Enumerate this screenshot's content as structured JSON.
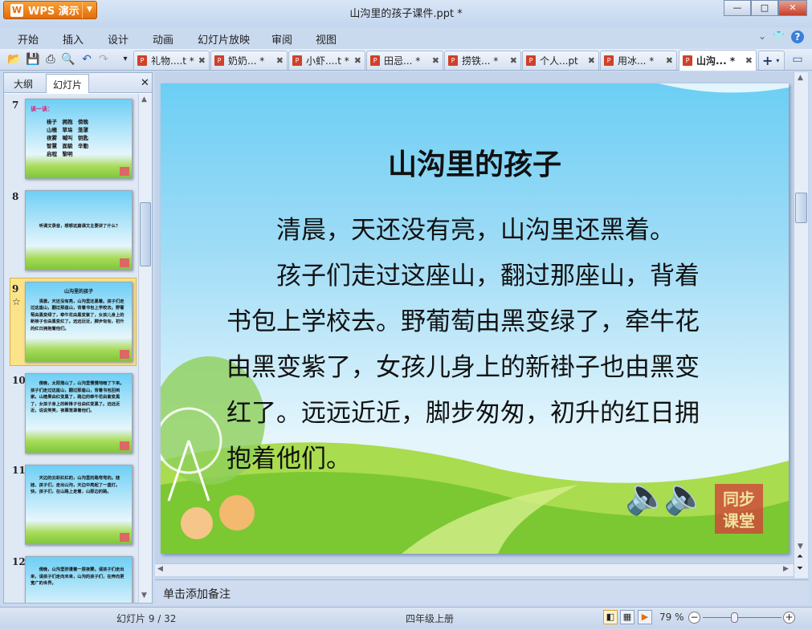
{
  "app": {
    "name": "WPS 演示",
    "title": "山沟里的孩子课件.ppt *"
  },
  "window": {
    "minimize": "—",
    "maximize": "□",
    "close": "✕"
  },
  "menu": [
    "开始",
    "插入",
    "设计",
    "动画",
    "幻灯片放映",
    "审阅",
    "视图"
  ],
  "doc_tabs": [
    {
      "label": "礼物....t *"
    },
    {
      "label": "奶奶... *"
    },
    {
      "label": "小虾....t *"
    },
    {
      "label": "田忌... *"
    },
    {
      "label": "捞铁... *"
    },
    {
      "label": "个人...pt"
    },
    {
      "label": "用冰... *"
    },
    {
      "label": "山沟... *",
      "active": true
    }
  ],
  "left_tabs": {
    "outline": "大纲",
    "slides": "幻灯片"
  },
  "thumbnails": [
    {
      "num": "7",
      "heading": "读一读：",
      "text": "褂子　拥抱　傍晚\n山楂　草垛　笼罩\n夜雾　喊叫　钥匙\n智慧　面貌　辛勤\n启程　黎明"
    },
    {
      "num": "8",
      "text": "听课文录音，想想这篇课文主要讲了什么？"
    },
    {
      "num": "9",
      "heading": "山沟里的孩子",
      "text": "清晨，天还没有亮，山沟里还黑着。孩子们走过这座山，翻过那座山，背着书包上学校去。野葡萄由黑变绿了，牵牛花由黑变紫了，女孩儿身上的新褂子也由黑变红了。远远近近，脚步匆匆，初升的红日拥抱着他们。",
      "selected": true
    },
    {
      "num": "10",
      "text": "傍晚，太阳落山了，山沟里慢慢地暗了下来。孩子们走过这座山，翻过那座山，背着书包回到家。山楂果由红变黑了，路边的牵牛花由紫变黑了，女孩子身上的新褂子也由红变黑了。远远近近，说说笑笑，夜幕笼罩着他们。"
    },
    {
      "num": "11",
      "text": "天边的云彩红红的，山沟里的路弯弯的。娃娃、孩子们，走出山沟，天边中亮起了一盏灯。快，孩子们，在山路上走着，山那边的路。"
    },
    {
      "num": "12",
      "text": "傍晚，山沟里弥漫着一层夜雾。请孩子们走出来，请孩子们走向未来，山沟的孩子们，在奔向更宽广的世界。"
    }
  ],
  "slide": {
    "title": "山沟里的孩子",
    "paragraphs": [
      "清晨，天还没有亮，山沟里还黑着。",
      "孩子们走过这座山，翻过那座山，背着书包上学校去。野葡萄由黑变绿了，牵牛花由黑变紫了，女孩儿身上的新褂子也由黑变红了。远远近近，脚步匆匆，初升的红日拥抱着他们。"
    ],
    "stamp": "同步课堂"
  },
  "notes_placeholder": "单击添加备注",
  "status": {
    "slide_counter": "幻灯片 9 / 32",
    "template": "四年级上册",
    "zoom": "79 %"
  },
  "zoom_level": 0.79
}
